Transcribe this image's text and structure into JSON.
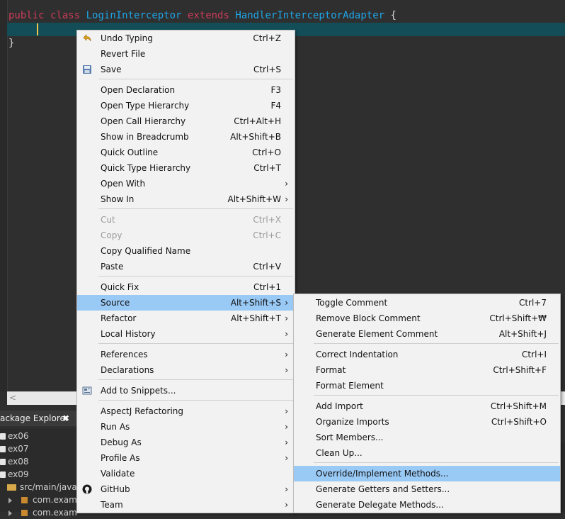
{
  "editor": {
    "code": {
      "line1": {
        "kw1": "public",
        "kw2": "class",
        "name": "LoginInterceptor",
        "kw3": "extends",
        "parent": "HandlerInterceptorAdapter",
        "brace": "{"
      },
      "line3": "}"
    },
    "scroll_left_glyph": "<"
  },
  "package_explorer": {
    "title": "ackage Explorer",
    "close_glyph": "✖",
    "items": [
      {
        "label": "ex06"
      },
      {
        "label": "ex07"
      },
      {
        "label": "ex08"
      },
      {
        "label": "ex09"
      }
    ],
    "src_folder": "src/main/java",
    "packages": [
      "com.examp",
      "com.exam"
    ]
  },
  "context_menu": {
    "items": [
      {
        "label": "Undo Typing",
        "shortcut": "Ctrl+Z",
        "icon": "undo-icon"
      },
      {
        "label": "Revert File"
      },
      {
        "label": "Save",
        "shortcut": "Ctrl+S",
        "icon": "save-icon"
      },
      {
        "label": "Open Declaration",
        "shortcut": "F3"
      },
      {
        "label": "Open Type Hierarchy",
        "shortcut": "F4"
      },
      {
        "label": "Open Call Hierarchy",
        "shortcut": "Ctrl+Alt+H"
      },
      {
        "label": "Show in Breadcrumb",
        "shortcut": "Alt+Shift+B"
      },
      {
        "label": "Quick Outline",
        "shortcut": "Ctrl+O"
      },
      {
        "label": "Quick Type Hierarchy",
        "shortcut": "Ctrl+T"
      },
      {
        "label": "Open With"
      },
      {
        "label": "Show In",
        "shortcut": "Alt+Shift+W"
      },
      {
        "label": "Cut",
        "shortcut": "Ctrl+X",
        "disabled": true
      },
      {
        "label": "Copy",
        "shortcut": "Ctrl+C",
        "disabled": true
      },
      {
        "label": "Copy Qualified Name"
      },
      {
        "label": "Paste",
        "shortcut": "Ctrl+V"
      },
      {
        "label": "Quick Fix",
        "shortcut": "Ctrl+1"
      },
      {
        "label": "Source",
        "shortcut": "Alt+Shift+S",
        "highlighted": true
      },
      {
        "label": "Refactor",
        "shortcut": "Alt+Shift+T"
      },
      {
        "label": "Local History"
      },
      {
        "label": "References"
      },
      {
        "label": "Declarations"
      },
      {
        "label": "Add to Snippets...",
        "icon": "snippets-icon"
      },
      {
        "label": "AspectJ Refactoring"
      },
      {
        "label": "Run As"
      },
      {
        "label": "Debug As"
      },
      {
        "label": "Profile As"
      },
      {
        "label": "Validate"
      },
      {
        "label": "GitHub",
        "icon": "github-icon"
      },
      {
        "label": "Team"
      }
    ],
    "submenu_arrow": "›"
  },
  "source_submenu": {
    "items": [
      {
        "label": "Toggle Comment",
        "shortcut": "Ctrl+7"
      },
      {
        "label": "Remove Block Comment",
        "shortcut": "Ctrl+Shift+₩"
      },
      {
        "label": "Generate Element Comment",
        "shortcut": "Alt+Shift+J"
      },
      {
        "label": "Correct Indentation",
        "shortcut": "Ctrl+I"
      },
      {
        "label": "Format",
        "shortcut": "Ctrl+Shift+F"
      },
      {
        "label": "Format Element"
      },
      {
        "label": "Add Import",
        "shortcut": "Ctrl+Shift+M"
      },
      {
        "label": "Organize Imports",
        "shortcut": "Ctrl+Shift+O"
      },
      {
        "label": "Sort Members..."
      },
      {
        "label": "Clean Up..."
      },
      {
        "label": "Override/Implement Methods...",
        "highlighted": true
      },
      {
        "label": "Generate Getters and Setters..."
      },
      {
        "label": "Generate Delegate Methods..."
      }
    ]
  },
  "colors": {
    "keyword": "#cc3c5a",
    "class_name": "#1fa5e6",
    "current_line": "#134d57",
    "menu_highlight": "#99c9f5"
  }
}
